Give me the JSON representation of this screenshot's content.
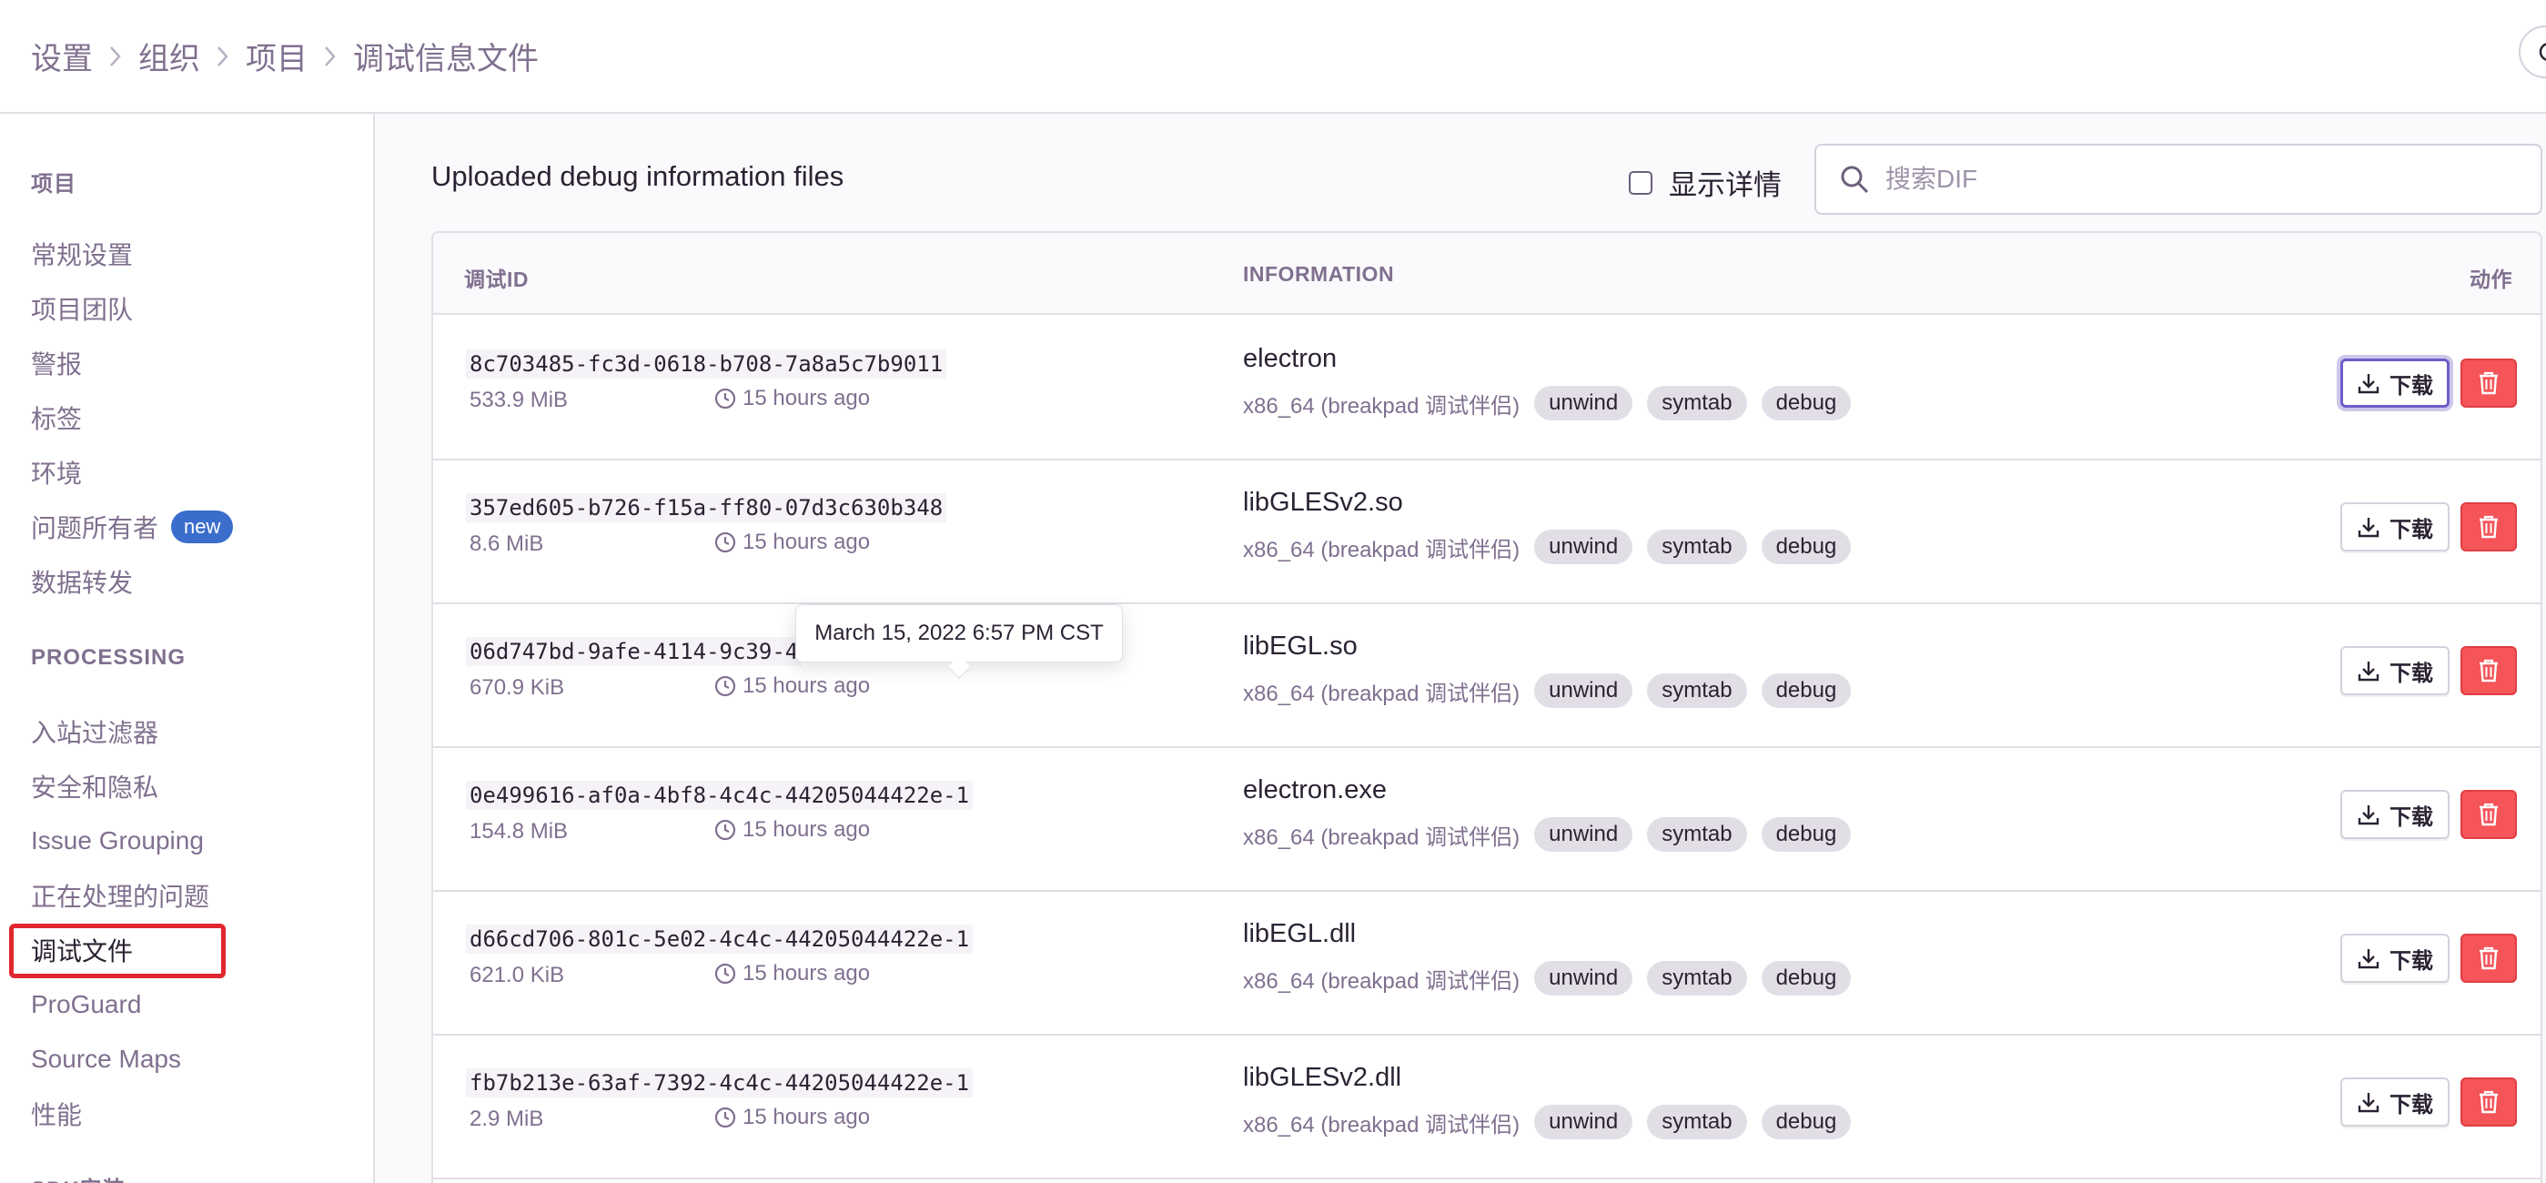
{
  "breadcrumb": [
    "设置",
    "组织",
    "项目",
    "调试信息文件"
  ],
  "sidebar": {
    "section1_title": "项目",
    "section1_items": [
      "常规设置",
      "项目团队",
      "警报",
      "标签",
      "环境",
      "问题所有者",
      "数据转发"
    ],
    "badge_new": "new",
    "section2_title": "PROCESSING",
    "section2_items": [
      "入站过滤器",
      "安全和隐私",
      "Issue Grouping",
      "正在处理的问题",
      "调试文件",
      "ProGuard",
      "Source Maps",
      "性能"
    ],
    "section3_title": "SDK安装",
    "active_item": "调试文件"
  },
  "main": {
    "title": "Uploaded debug information files",
    "detail_toggle_label": "显示详情",
    "search_placeholder": "搜索DIF",
    "columns": {
      "id": "调试ID",
      "info": "INFORMATION",
      "action": "动作"
    },
    "download_label": "下载",
    "rows": [
      {
        "id": "8c703485-fc3d-0618-b708-7a8a5c7b9011",
        "size": "533.9 MiB",
        "time": "15 hours ago",
        "name": "electron",
        "arch": "x86_64 (breakpad 调试伴侣)",
        "tags": [
          "unwind",
          "symtab",
          "debug"
        ]
      },
      {
        "id": "357ed605-b726-f15a-ff80-07d3c630b348",
        "size": "8.6 MiB",
        "time": "15 hours ago",
        "name": "libGLESv2.so",
        "arch": "x86_64 (breakpad 调试伴侣)",
        "tags": [
          "unwind",
          "symtab",
          "debug"
        ]
      },
      {
        "id": "06d747bd-9afe-4114-9c39-4",
        "size": "670.9 KiB",
        "time": "15 hours ago",
        "name": "libEGL.so",
        "arch": "x86_64 (breakpad 调试伴侣)",
        "tags": [
          "unwind",
          "symtab",
          "debug"
        ]
      },
      {
        "id": "0e499616-af0a-4bf8-4c4c-44205044422e-1",
        "size": "154.8 MiB",
        "time": "15 hours ago",
        "name": "electron.exe",
        "arch": "x86_64 (breakpad 调试伴侣)",
        "tags": [
          "unwind",
          "symtab",
          "debug"
        ]
      },
      {
        "id": "d66cd706-801c-5e02-4c4c-44205044422e-1",
        "size": "621.0 KiB",
        "time": "15 hours ago",
        "name": "libEGL.dll",
        "arch": "x86_64 (breakpad 调试伴侣)",
        "tags": [
          "unwind",
          "symtab",
          "debug"
        ]
      },
      {
        "id": "fb7b213e-63af-7392-4c4c-44205044422e-1",
        "size": "2.9 MiB",
        "time": "15 hours ago",
        "name": "libGLESv2.dll",
        "arch": "x86_64 (breakpad 调试伴侣)",
        "tags": [
          "unwind",
          "symtab",
          "debug"
        ]
      }
    ],
    "tooltip": "March 15, 2022 6:57 PM CST"
  },
  "colors": {
    "accent": "#6c5fc7",
    "danger": "#f55459",
    "highlight": "#e0262e",
    "badge": "#3b6ecc"
  }
}
